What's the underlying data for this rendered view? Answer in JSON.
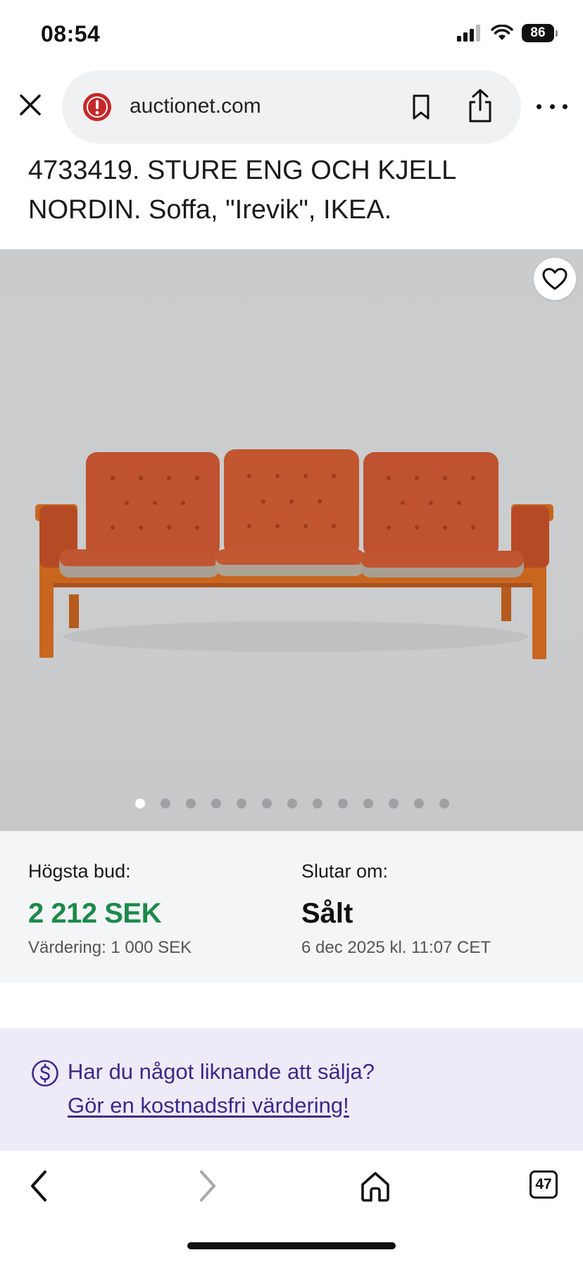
{
  "status": {
    "time": "08:54",
    "battery": "86"
  },
  "browser": {
    "url": "auctionet.com",
    "tab_count": "47"
  },
  "lot": {
    "title": "4733419. STURE ENG OCH KJELL NORDIN. Soffa, \"Irevik\", IKEA."
  },
  "gallery": {
    "image_count": 13,
    "active_index": 0
  },
  "info": {
    "bid_label": "Högsta bud:",
    "bid_value": "2 212 SEK",
    "valuation": "Värdering: 1 000 SEK",
    "ends_label": "Slutar om:",
    "ends_value": "Sålt",
    "ends_date": "6 dec 2025 kl. 11:07 CET"
  },
  "sell": {
    "question": "Har du något liknande att sälja?",
    "link": "Gör en kostnadsfri värdering!"
  },
  "colors": {
    "bid_green": "#1d8a4a",
    "banner_bg": "#eeeaf8",
    "banner_text": "#3b2a8a",
    "alert_red": "#c62828"
  }
}
